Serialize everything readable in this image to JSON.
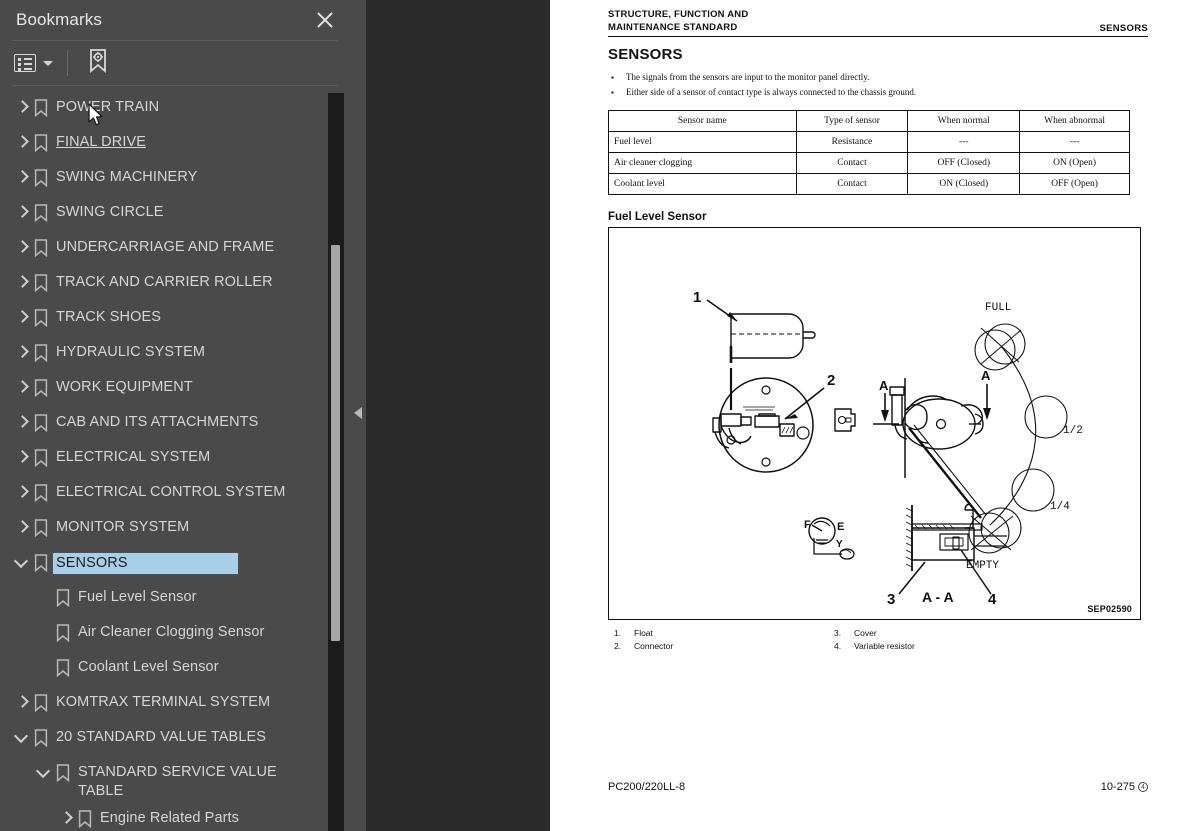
{
  "sidebar": {
    "title": "Bookmarks",
    "close_icon": "close-icon",
    "toolbar": {
      "list_options_icon": "list-options-icon",
      "caret_icon": "chevron-down-icon",
      "bookmark_settings_icon": "bookmark-gear-icon"
    },
    "items": [
      {
        "label": "POWER TRAIN",
        "level": 0,
        "state": "closed",
        "selected": false,
        "hovered": false
      },
      {
        "label": "FINAL DRIVE",
        "level": 0,
        "state": "closed",
        "selected": false,
        "hovered": true
      },
      {
        "label": "SWING MACHINERY",
        "level": 0,
        "state": "closed",
        "selected": false,
        "hovered": false
      },
      {
        "label": "SWING CIRCLE",
        "level": 0,
        "state": "closed",
        "selected": false,
        "hovered": false
      },
      {
        "label": "UNDERCARRIAGE AND FRAME",
        "level": 0,
        "state": "closed",
        "selected": false,
        "hovered": false
      },
      {
        "label": "TRACK AND CARRIER ROLLER",
        "level": 0,
        "state": "closed",
        "selected": false,
        "hovered": false
      },
      {
        "label": "TRACK SHOES",
        "level": 0,
        "state": "closed",
        "selected": false,
        "hovered": false
      },
      {
        "label": "HYDRAULIC SYSTEM",
        "level": 0,
        "state": "closed",
        "selected": false,
        "hovered": false
      },
      {
        "label": "WORK EQUIPMENT",
        "level": 0,
        "state": "closed",
        "selected": false,
        "hovered": false
      },
      {
        "label": "CAB AND ITS ATTACHMENTS",
        "level": 0,
        "state": "closed",
        "selected": false,
        "hovered": false
      },
      {
        "label": "ELECTRICAL SYSTEM",
        "level": 0,
        "state": "closed",
        "selected": false,
        "hovered": false
      },
      {
        "label": "ELECTRICAL CONTROL SYSTEM",
        "level": 0,
        "state": "closed",
        "selected": false,
        "hovered": false
      },
      {
        "label": "MONITOR SYSTEM",
        "level": 0,
        "state": "closed",
        "selected": false,
        "hovered": false
      },
      {
        "label": "SENSORS",
        "level": 0,
        "state": "open",
        "selected": true,
        "hovered": false
      },
      {
        "label": "Fuel Level Sensor",
        "level": 1,
        "state": "none",
        "selected": false,
        "hovered": false
      },
      {
        "label": "Air Cleaner Clogging Sensor",
        "level": 1,
        "state": "none",
        "selected": false,
        "hovered": false
      },
      {
        "label": "Coolant Level Sensor",
        "level": 1,
        "state": "none",
        "selected": false,
        "hovered": false
      },
      {
        "label": "KOMTRAX TERMINAL SYSTEM",
        "level": 0,
        "state": "closed",
        "selected": false,
        "hovered": false
      },
      {
        "label": "20 STANDARD VALUE TABLES",
        "level": 0,
        "state": "open",
        "selected": false,
        "hovered": false,
        "noindent": true
      },
      {
        "label": "STANDARD SERVICE VALUE TABLE",
        "level": 1,
        "state": "open",
        "selected": false,
        "hovered": false
      },
      {
        "label": "Engine Related Parts",
        "level": 2,
        "state": "closed",
        "selected": false,
        "hovered": false
      }
    ],
    "scrollbar": {
      "name": "sidebar-scrollbar"
    }
  },
  "gutter": {
    "collapse_handle_icon": "collapse-left-icon"
  },
  "page": {
    "header": {
      "left_line1": "STRUCTURE, FUNCTION AND",
      "left_line2": "MAINTENANCE STANDARD",
      "right": "SENSORS"
    },
    "section_title": "SENSORS",
    "bullets": [
      "The signals from the sensors are input to the monitor panel directly.",
      "Either side of a sensor of contact type is always connected to the chassis ground."
    ],
    "table": {
      "headers": [
        "Sensor name",
        "Type of sensor",
        "When normal",
        "When abnormal"
      ],
      "rows": [
        [
          "Fuel level",
          "Resistance",
          "---",
          "---"
        ],
        [
          "Air cleaner clogging",
          "Contact",
          "OFF (Closed)",
          "ON (Open)"
        ],
        [
          "Coolant level",
          "Contact",
          "ON (Closed)",
          "OFF (Open)"
        ]
      ]
    },
    "figure": {
      "title": "Fuel Level Sensor",
      "id": "SEP02590",
      "callouts": [
        "1",
        "2",
        "3",
        "4"
      ],
      "annotations": [
        "FULL",
        "1/2",
        "1/4",
        "EMPTY",
        "A",
        "A",
        "A - A",
        "F",
        "E",
        "Y"
      ]
    },
    "legend": {
      "left": [
        {
          "num": "1.",
          "label": "Float"
        },
        {
          "num": "2.",
          "label": "Connector"
        }
      ],
      "right": [
        {
          "num": "3.",
          "label": "Cover"
        },
        {
          "num": "4.",
          "label": "Variable resistor"
        }
      ]
    },
    "footer": {
      "left": "PC200/220LL-8",
      "right": "10-275",
      "right_mark": "4"
    }
  }
}
